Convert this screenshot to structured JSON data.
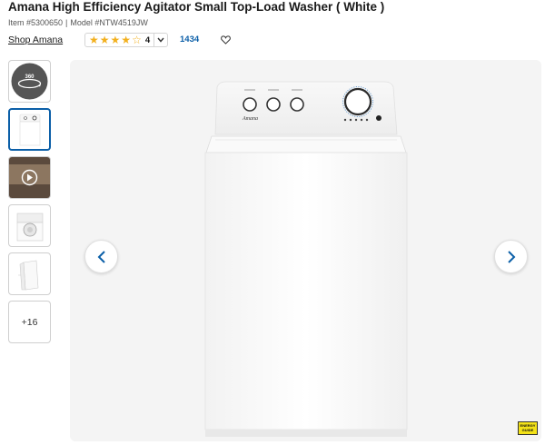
{
  "product": {
    "title": "Amana High Efficiency Agitator Small Top-Load Washer ( White )",
    "item_number": "Item #5300650",
    "separator": "|",
    "model_number": "Model #NTW4519JW"
  },
  "brand_link": "Shop Amana",
  "rating": {
    "value": "4",
    "stars_filled": 4,
    "stars_total": 5,
    "review_count": "1434",
    "star_color": "#f2b01e"
  },
  "gallery": {
    "thumbnails": [
      {
        "kind": "360 view",
        "label": "360"
      },
      {
        "kind": "washer front image"
      },
      {
        "kind": "video"
      },
      {
        "kind": "washer top-open image"
      },
      {
        "kind": "washer side image"
      }
    ],
    "more_label": "+16",
    "active_index": 1
  },
  "energy_badge": "ENERGY GUIDE",
  "washer": {
    "brand_mark": "Amana"
  },
  "colors": {
    "link_blue": "#0b5fa8",
    "viewer_bg": "#f4f4f4",
    "active_border": "#0b5fa8"
  }
}
